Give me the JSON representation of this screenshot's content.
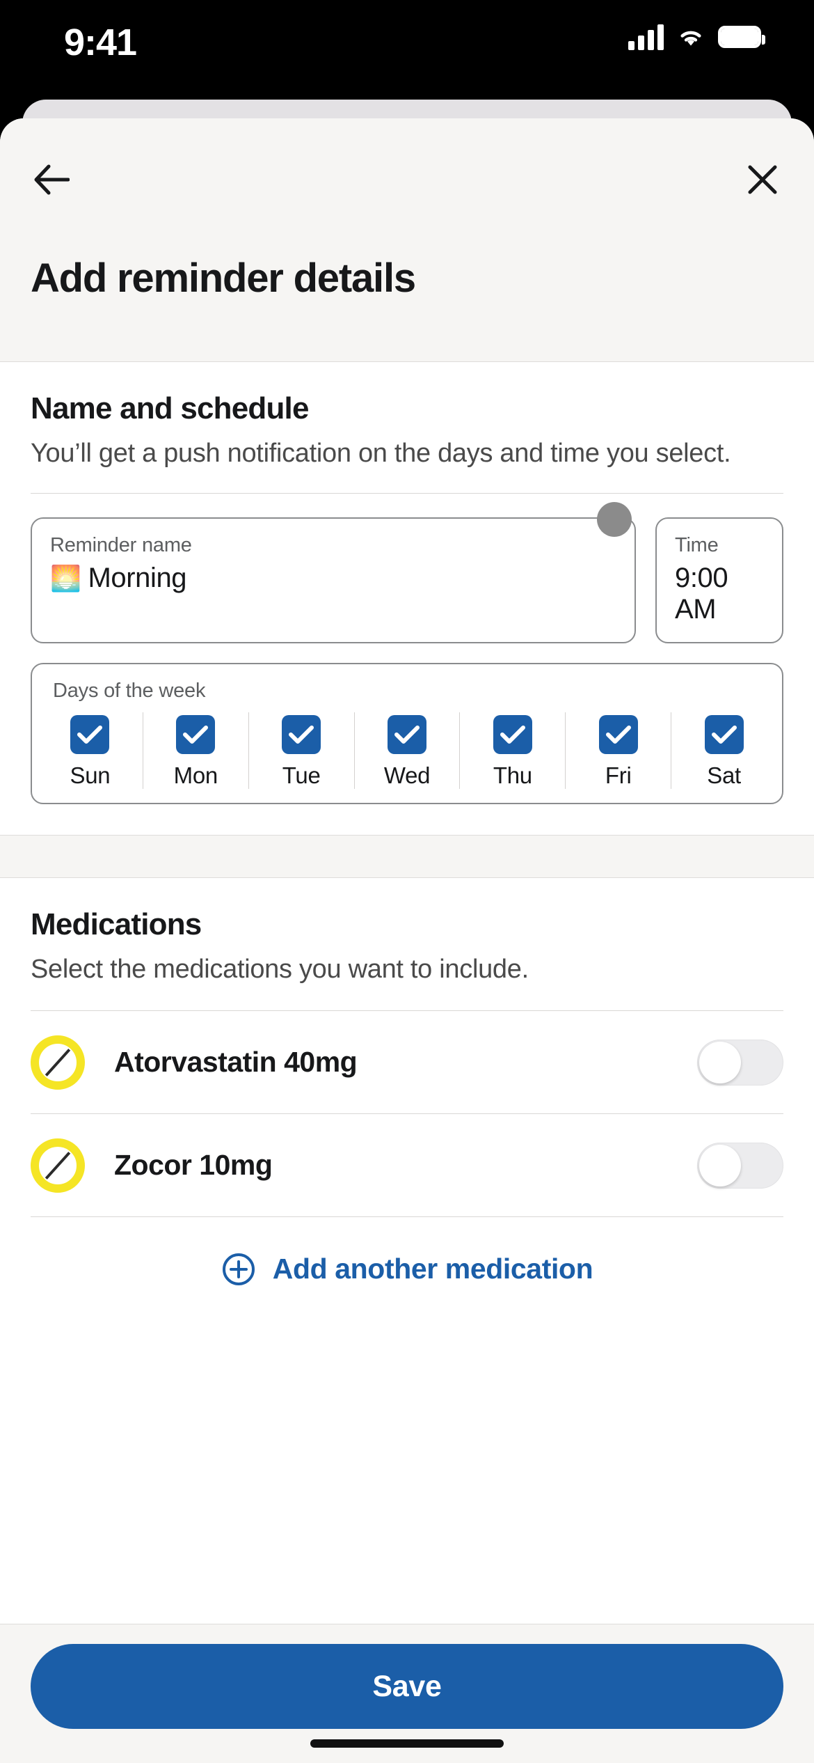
{
  "status_bar": {
    "time": "9:41",
    "icons": [
      "cellular-signal-icon",
      "wifi-icon",
      "battery-icon"
    ]
  },
  "header": {
    "title": "Add reminder details",
    "back_icon": "back-arrow-icon",
    "close_icon": "close-icon"
  },
  "schedule_section": {
    "title": "Name and schedule",
    "subtitle": "You’ll get a push notification on the days and time you select.",
    "reminder_name": {
      "label": "Reminder name",
      "emoji": "🌅",
      "value": "Morning",
      "placeholder": "Reminder name"
    },
    "time": {
      "label": "Time",
      "value": "9:00 AM"
    },
    "days": {
      "label": "Days of the week",
      "items": [
        {
          "name": "Sun",
          "checked": true
        },
        {
          "name": "Mon",
          "checked": true
        },
        {
          "name": "Tue",
          "checked": true
        },
        {
          "name": "Wed",
          "checked": true
        },
        {
          "name": "Thu",
          "checked": true
        },
        {
          "name": "Fri",
          "checked": true
        },
        {
          "name": "Sat",
          "checked": true
        }
      ]
    }
  },
  "medications_section": {
    "title": "Medications",
    "subtitle": "Select the medications you want to include.",
    "items": [
      {
        "name": "Atorvastatin 40mg",
        "icon": "pill-icon",
        "enabled": false
      },
      {
        "name": "Zocor 10mg",
        "icon": "pill-icon",
        "enabled": false
      }
    ],
    "add_label": "Add another medication",
    "add_icon": "plus-circle-icon"
  },
  "footer": {
    "save_label": "Save"
  },
  "colors": {
    "accent_blue": "#1B5EA8",
    "pill_yellow": "#F5E525",
    "sheet_bg": "#F6F5F3"
  }
}
